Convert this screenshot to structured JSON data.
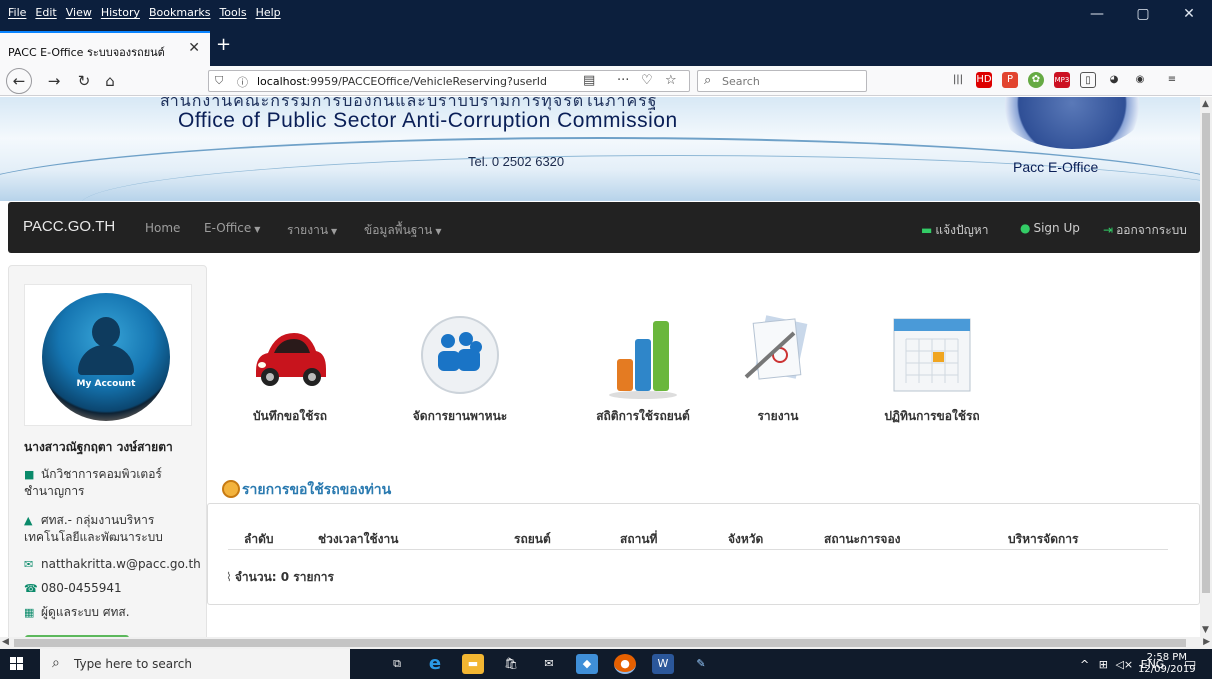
{
  "browser": {
    "menu": [
      "File",
      "Edit",
      "View",
      "History",
      "Bookmarks",
      "Tools",
      "Help"
    ],
    "window_controls": [
      "—",
      "▢",
      "✕"
    ],
    "tab_title": "PACC E-Office ระบบจองรถยนต์",
    "tab_close": "✕",
    "new_tab": "+",
    "url_host": "localhost",
    "url_rest": ":9959/PACCEOffice/VehicleReserving?userId",
    "search_placeholder": "Search"
  },
  "banner": {
    "thai_org": "สำนักงานคณะกรรมการป้องกันและปราบปรามการทุจริตในภาครัฐ",
    "org_en": "Office of Public Sector  Anti-Corruption Commission",
    "tel": "Tel. 0 2502 6320",
    "brand": "Pacc E-Office"
  },
  "nav": {
    "brand": "PACC.GO.TH",
    "home": "Home",
    "eoffice": "E-Office",
    "report": "รายงาน",
    "basedata": "ข้อมูลพื้นฐาน",
    "issue": "แจ้งปัญหา",
    "signup": "Sign Up",
    "logout": "ออกจากระบบ"
  },
  "sidebar": {
    "avatar_caption": "My Account",
    "name": "นางสาวณัฐกฤตา วงษ์สายตา",
    "position": "นักวิชาการคอมพิวเตอร์ ชำนาญการ",
    "department": "ศทส.- กลุ่มงานบริหาร เทคโนโลยีและพัฒนาระบบ",
    "email": "natthakritta.w@pacc.go.th",
    "phone": "080-0455941",
    "admin": "ผู้ดูแลระบบ ศทส."
  },
  "menu_icons": {
    "record": "บันทึกขอใช้รถ",
    "manage": "จัดการยานพาหนะ",
    "stats": "สถิติการใช้รถยนต์",
    "report": "รายงาน",
    "calendar": "ปฏิทินการขอใช้รถ"
  },
  "requests": {
    "title": "รายการขอใช้รถของท่าน",
    "columns": [
      "ลำดับ",
      "ช่วงเวลาใช้งาน",
      "รถยนต์",
      "สถานที่",
      "จังหวัด",
      "สถานะการจอง",
      "บริหารจัดการ"
    ],
    "count_label": "จำนวน: 0 รายการ"
  },
  "taskbar": {
    "search_placeholder": "Type here to search",
    "lang": "ENG",
    "time": "2:58 PM",
    "date": "12/09/2019"
  }
}
